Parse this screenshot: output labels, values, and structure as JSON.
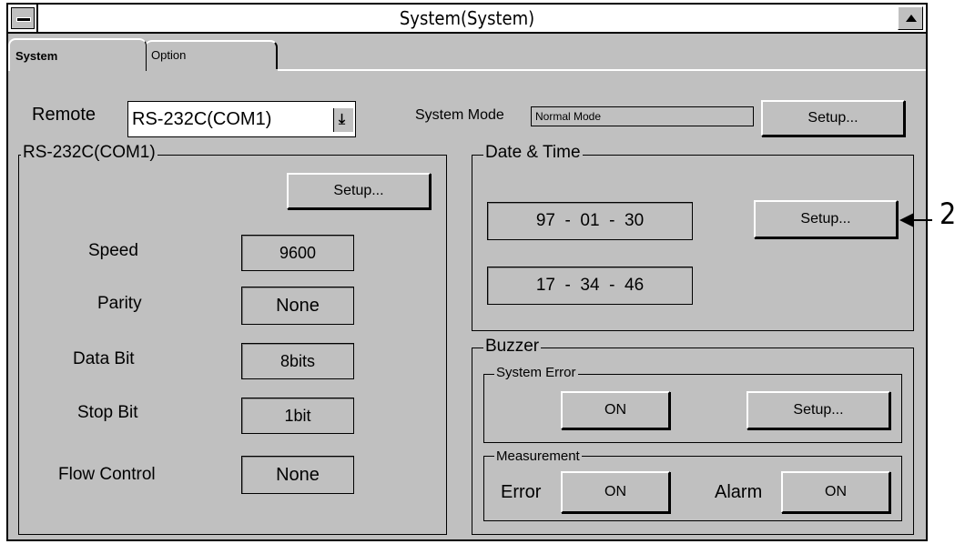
{
  "window": {
    "title": "System(System)"
  },
  "tabs": [
    {
      "label": "System",
      "active": true
    },
    {
      "label": "Option",
      "active": false
    }
  ],
  "remote": {
    "label": "Remote",
    "value": "RS-232C(COM1)",
    "arrow_icon": "⤓"
  },
  "system_mode": {
    "label": "System Mode",
    "value": "Normal Mode",
    "setup_label": "Setup..."
  },
  "rs232": {
    "title": "RS-232C(COM1)",
    "setup_label": "Setup...",
    "rows": [
      {
        "label": "Speed",
        "value": "9600"
      },
      {
        "label": "Parity",
        "value": "None"
      },
      {
        "label": "Data Bit",
        "value": "8bits"
      },
      {
        "label": "Stop Bit",
        "value": "1bit"
      },
      {
        "label": "Flow Control",
        "value": "None"
      }
    ]
  },
  "datetime": {
    "title": "Date & Time",
    "date": "97  -  01  -  30",
    "time": "17  -  34  -  46",
    "setup_label": "Setup..."
  },
  "buzzer": {
    "title": "Buzzer",
    "system_error": {
      "title": "System Error",
      "on_label": "ON",
      "setup_label": "Setup..."
    },
    "measurement": {
      "title": "Measurement",
      "error_label": "Error",
      "error_on": "ON",
      "alarm_label": "Alarm",
      "alarm_on": "ON"
    }
  },
  "callout": {
    "label": "2"
  }
}
